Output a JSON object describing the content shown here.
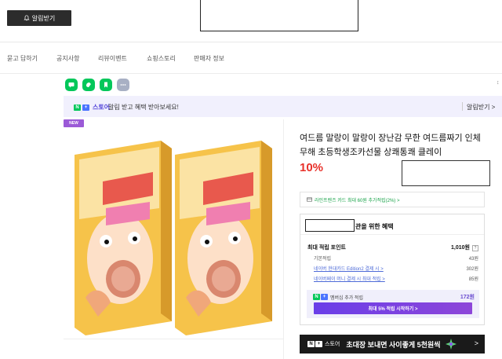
{
  "header": {
    "alarm_button": "알림받기"
  },
  "nav": {
    "items": [
      "묻고 답하기",
      "공지사항",
      "리뷰이벤트",
      "쇼핑스토리",
      "판매자 정보"
    ]
  },
  "share_icons": [
    "talk-icon",
    "band-icon",
    "bookmark-icon",
    "more-icon"
  ],
  "store_banner": {
    "logo_n": "N",
    "logo_plus": "+",
    "logo_text": "스토어",
    "message": "알림 받고 혜택 받아보세요!",
    "alarm_link": "알림받기 >"
  },
  "badge": "NEW",
  "product": {
    "title": "여드름 말랑이 말랑이 장난감 무한 여드름짜기 인체무해 초등학생조카선물 상쾌통쾌 클레이",
    "discount": "10%",
    "card_benefit": "라인프렌즈 카드 최대 60원 추가적립(2%) >"
  },
  "benefit": {
    "heading": "관을 위한 혜택",
    "max_points_label": "최대 적립 포인트",
    "max_points_value": "1,010원",
    "help": "?",
    "rows": [
      {
        "label": "기본적립",
        "value": "43원"
      },
      {
        "label": "네이버 현대카드 Edition2 결제 시 >",
        "value": "302원"
      },
      {
        "label": "네이버페이 머니 결제 시 최대 적립 >",
        "value": "85원"
      }
    ],
    "membership_label": "멤버십 추가 적립",
    "membership_value": "172원",
    "membership_button": "최대 5% 적립 시작하기 >"
  },
  "bottom_banner": {
    "store": "스토어",
    "message": "초대장 보내면 사이좋게 5천원씩",
    "arrow": ">"
  },
  "colors": {
    "brand_green": "#03c75a",
    "store_purple": "#4e3fd8",
    "discount_red": "#e8312a",
    "new_badge": "#9b5ad7"
  }
}
